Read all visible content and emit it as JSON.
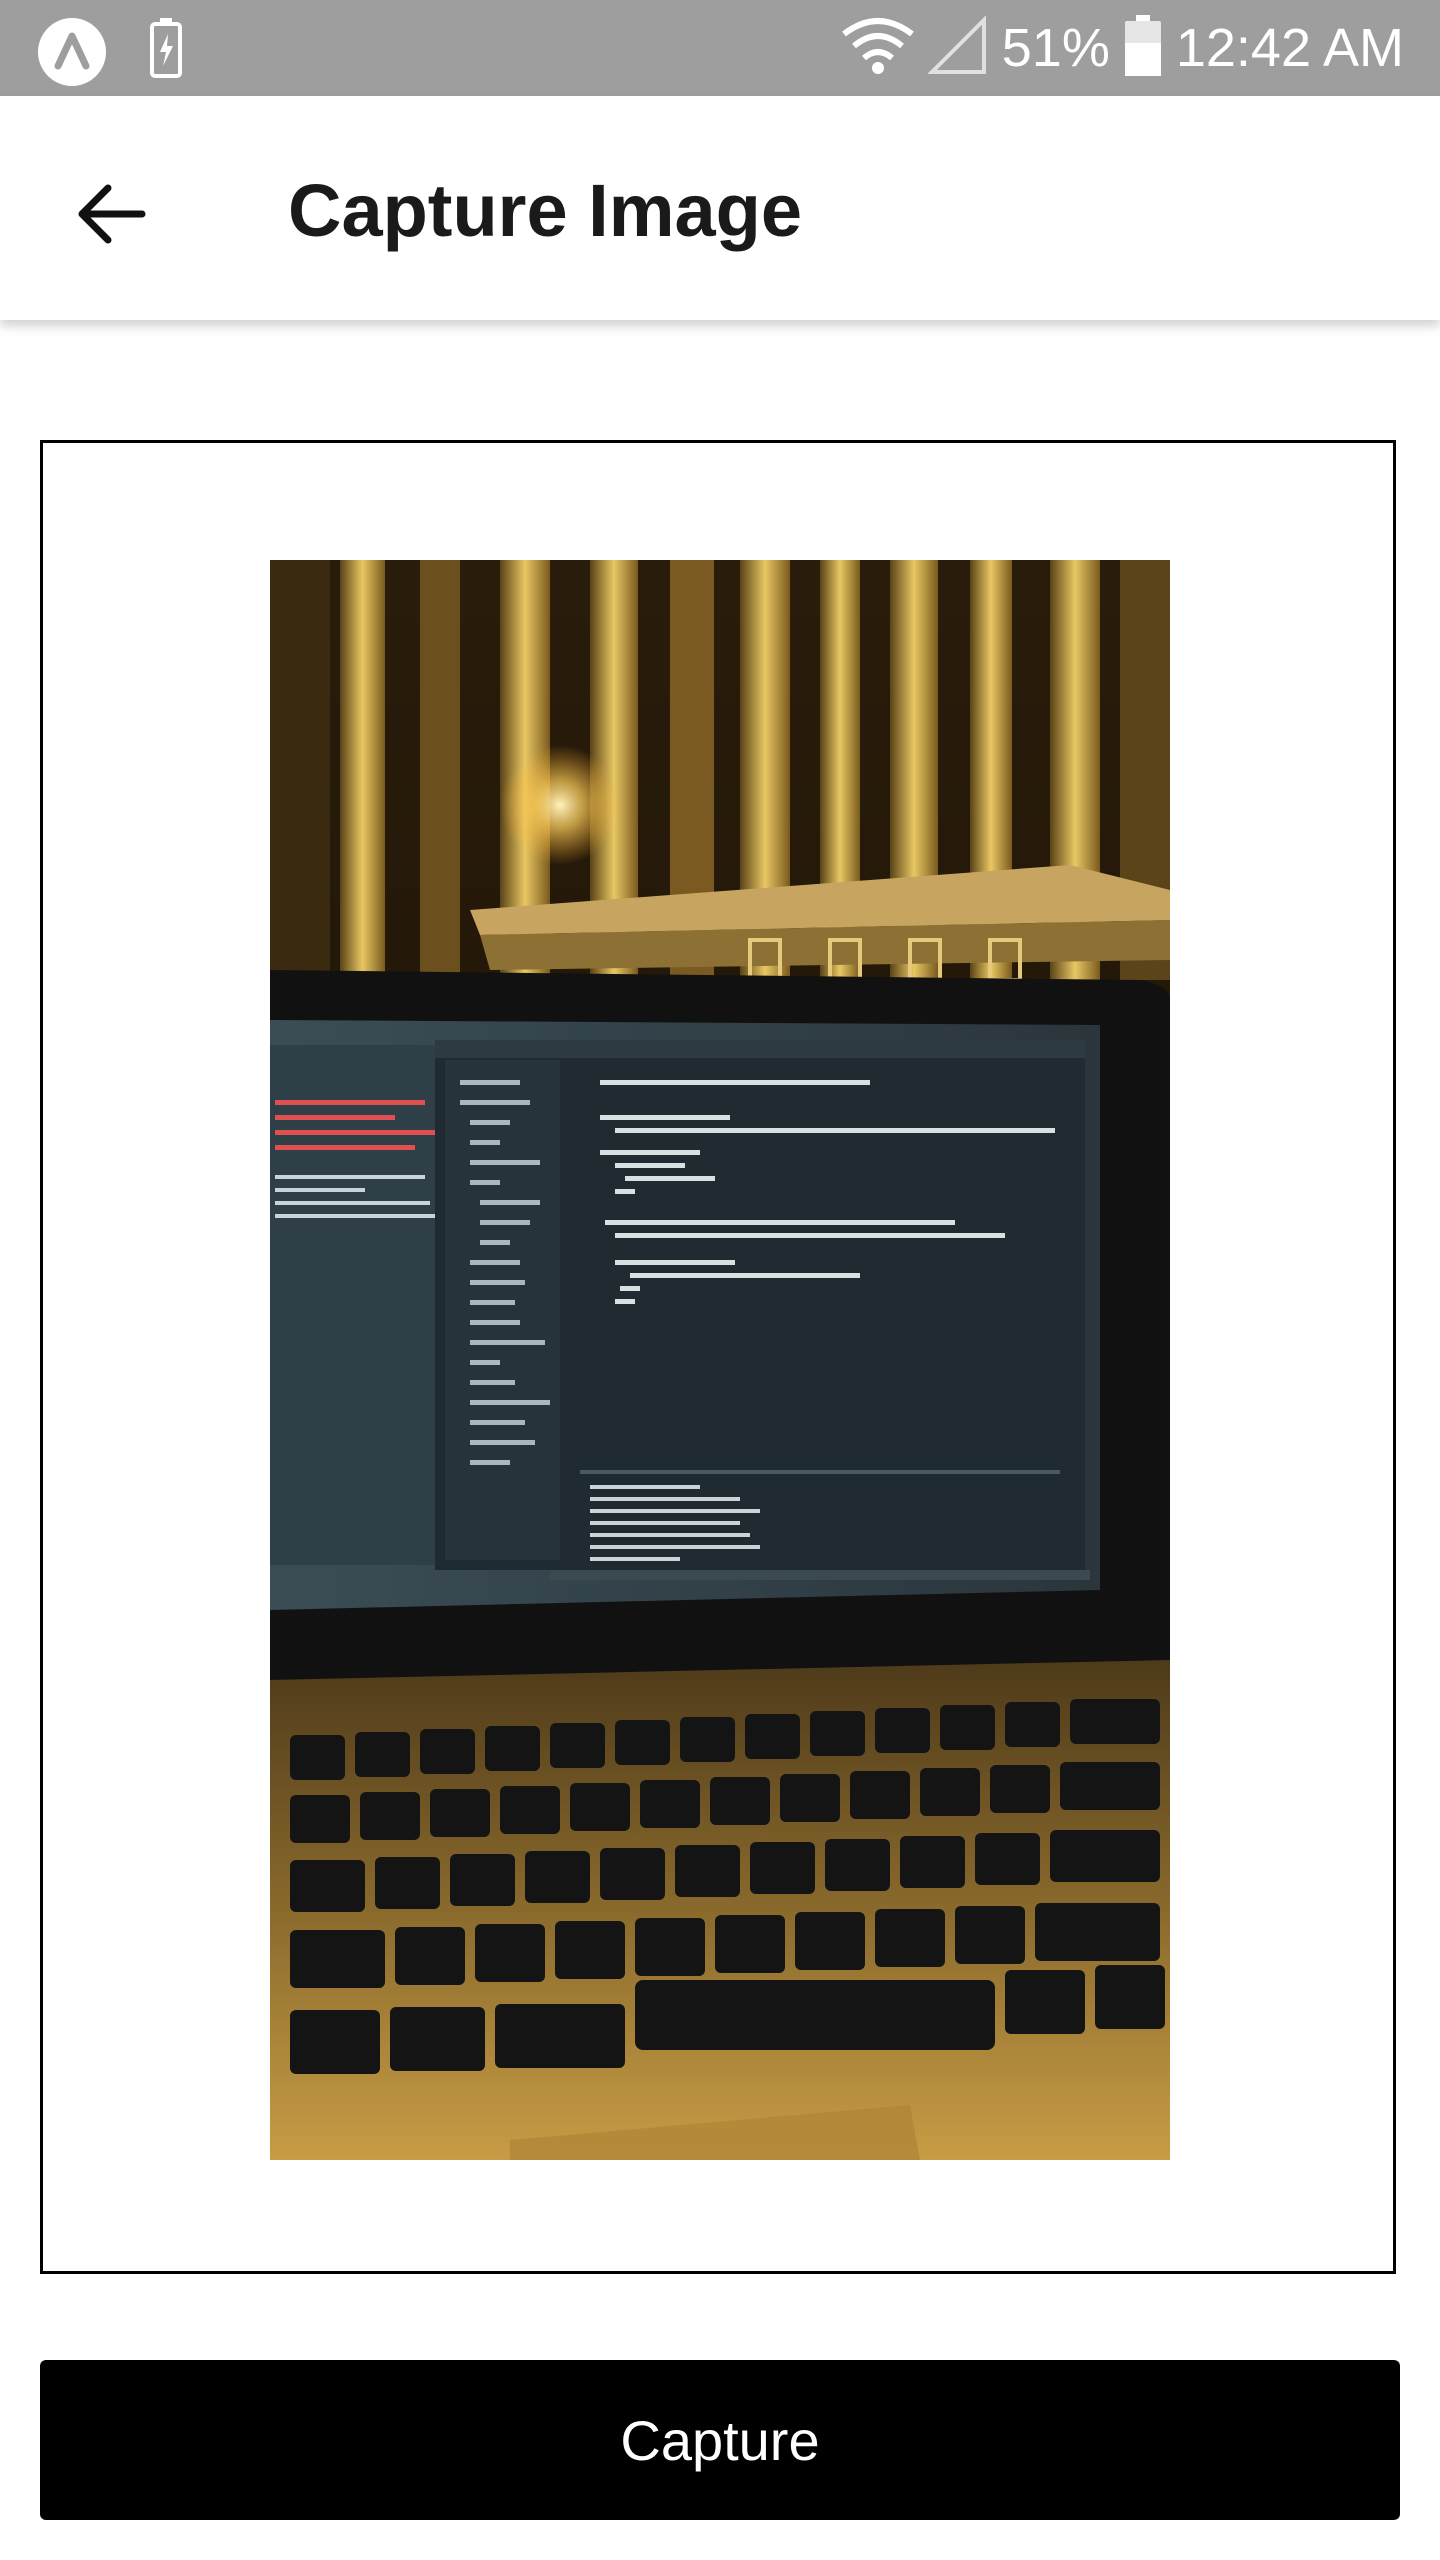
{
  "status_bar": {
    "battery_percent": "51%",
    "time": "12:42 AM",
    "icons": [
      "app-logo-icon",
      "battery-saver-icon",
      "wifi-icon",
      "cell-signal-icon",
      "battery-icon"
    ]
  },
  "app_bar": {
    "title": "Capture Image",
    "back_icon": "arrow-left-icon"
  },
  "preview": {
    "description_icon": "captured-photo"
  },
  "capture_button": {
    "label": "Capture"
  },
  "colors": {
    "status_bar_bg": "#9e9e9e",
    "button_bg": "#000000",
    "button_text": "#ffffff"
  }
}
